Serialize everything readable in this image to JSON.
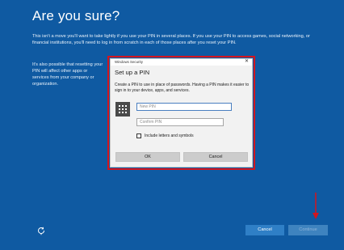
{
  "page": {
    "title": "Are you sure?",
    "paragraph_1": "This isn't a move you'll want to take lightly if you use your PIN in several places. If you use your PIN to access games, social networking, or financial institutions, you'll need to log in from scratch in each of those places after you reset your PIN.",
    "paragraph_2": "It's also possible that resetting your PIN will affect other apps or services from your company or organization.",
    "refresh_icon": "refresh-icon",
    "background_color": "#0f5aa2"
  },
  "footer": {
    "cancel_label": "Cancel",
    "continue_label": "Continue"
  },
  "dialog": {
    "window_title": "Windows Security",
    "close_glyph": "✕",
    "heading": "Set up a PIN",
    "description": "Create a PIN to use in place of passwords. Having a PIN makes it easier to sign in to your device, apps, and services.",
    "new_pin_placeholder": "New PIN",
    "confirm_pin_placeholder": "Confirm PIN",
    "new_pin_value": "",
    "confirm_pin_value": "",
    "checkbox_label": "Include letters and symbols",
    "checkbox_checked": false,
    "ok_label": "OK",
    "cancel_label": "Cancel",
    "keypad_icon": "keypad-icon",
    "highlight_color": "#d4151e"
  },
  "annotation": {
    "arrow_color": "#d4151e"
  }
}
